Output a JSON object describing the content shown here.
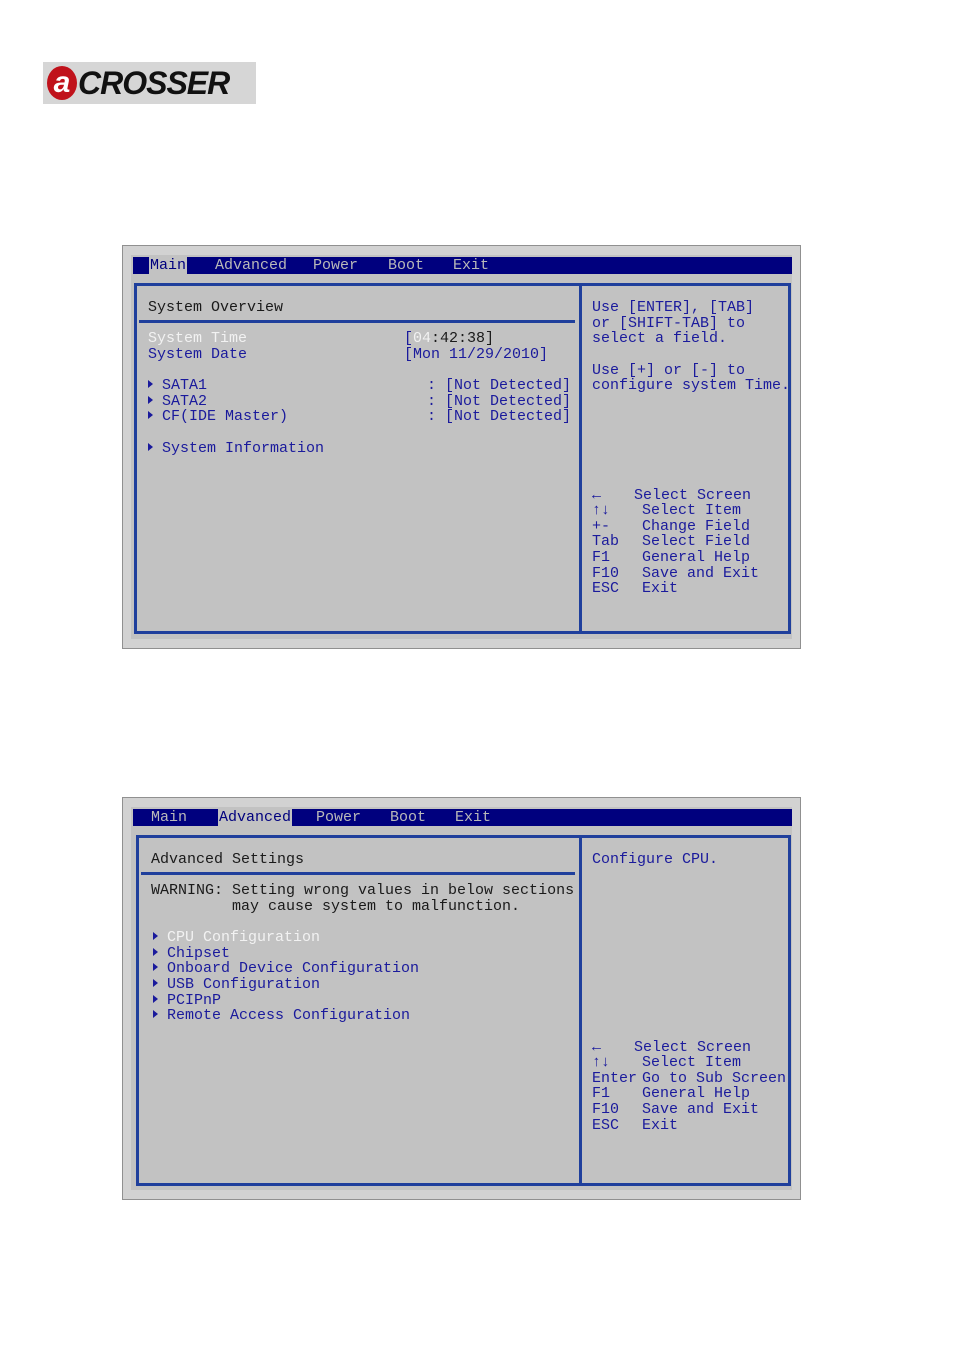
{
  "logo": {
    "mark": "a",
    "text": "CROSSER"
  },
  "screen1": {
    "menu": [
      "Main",
      "Advanced",
      "Power",
      "Boot",
      "Exit"
    ],
    "active_menu": "Main",
    "section_title": "System Overview",
    "system_time_label": "System Time",
    "system_time_value_hh": "04",
    "system_time_value_rest": ":42:38]",
    "system_date_label": "System Date",
    "system_date_value": "[Mon 11/29/2010]",
    "devices": [
      {
        "label": "SATA1",
        "value": ": [Not Detected]"
      },
      {
        "label": "SATA2",
        "value": ": [Not Detected]"
      },
      {
        "label": "CF(IDE Master)",
        "value": ": [Not Detected]"
      }
    ],
    "system_information": "System Information",
    "help_lines": [
      "Use [ENTER], [TAB]",
      "or [SHIFT-TAB] to",
      "select a field.",
      "",
      "Use [+] or [-] to",
      "configure system Time."
    ],
    "keys": [
      {
        "key": "←",
        "desc": "Select Screen"
      },
      {
        "key": "↑↓",
        "desc": "Select Item"
      },
      {
        "key": "+-",
        "desc": "Change Field"
      },
      {
        "key": "Tab",
        "desc": "Select Field"
      },
      {
        "key": "F1",
        "desc": "General Help"
      },
      {
        "key": "F10",
        "desc": "Save and Exit"
      },
      {
        "key": "ESC",
        "desc": "Exit"
      }
    ]
  },
  "screen2": {
    "menu": [
      "Main",
      "Advanced",
      "Power",
      "Boot",
      "Exit"
    ],
    "active_menu": "Advanced",
    "section_title": "Advanced Settings",
    "warning_line1": "WARNING: Setting wrong values in below sections",
    "warning_line2": "         may cause system to malfunction.",
    "items": [
      "CPU Configuration",
      "Chipset",
      "Onboard Device Configuration",
      "USB Configuration",
      "PCIPnP",
      "Remote Access Configuration"
    ],
    "help_text": "Configure CPU.",
    "keys": [
      {
        "key": "←",
        "desc": "Select Screen"
      },
      {
        "key": "↑↓",
        "desc": "Select Item"
      },
      {
        "key": "Enter",
        "desc": "Go to Sub Screen"
      },
      {
        "key": "F1",
        "desc": "General Help"
      },
      {
        "key": "F10",
        "desc": "Save and Exit"
      },
      {
        "key": "ESC",
        "desc": "Exit"
      }
    ]
  }
}
